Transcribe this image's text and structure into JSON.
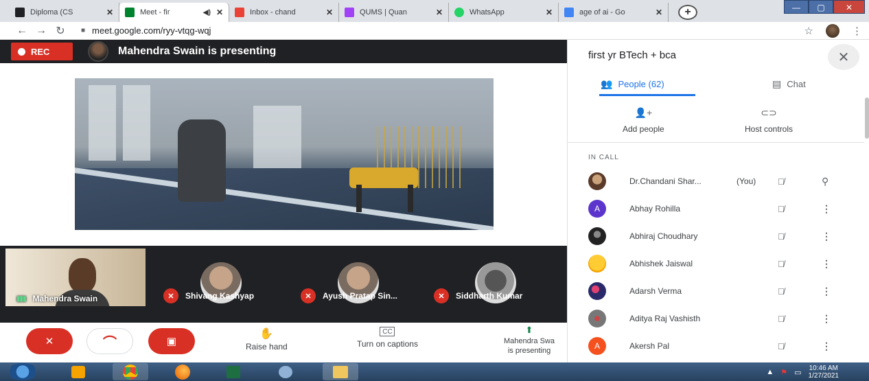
{
  "browser": {
    "tabs": [
      {
        "title": "Diploma (CS",
        "color": "#202124"
      },
      {
        "title": "Meet - fir",
        "color": "#00832d"
      },
      {
        "title": "Inbox - chand",
        "color": "#ea4335"
      },
      {
        "title": "QUMS | Quan",
        "color": "#a142f4"
      },
      {
        "title": "WhatsApp",
        "color": "#25d366"
      },
      {
        "title": "age of ai - Go",
        "color": "#4285f4"
      }
    ],
    "url": "meet.google.com/ryy-vtqg-wqj"
  },
  "meeting": {
    "rec_label": "REC",
    "presenting_text": "Mahendra Swain is presenting",
    "self_tile_name": "Mahendra Swain",
    "tiles": [
      {
        "name": "Shivang Kashyap"
      },
      {
        "name": "Ayush Pratap Sin..."
      },
      {
        "name": "Siddharth Kumar"
      }
    ],
    "controls": {
      "raise_hand": "Raise hand",
      "captions": "Turn on captions",
      "presenting_line1": "Mahendra Swa",
      "presenting_line2": "is presenting"
    }
  },
  "panel": {
    "title": "first yr BTech + bca",
    "tab_people": "People (62)",
    "tab_chat": "Chat",
    "add_people": "Add people",
    "host_controls": "Host controls",
    "in_call_label": "IN CALL",
    "people": [
      {
        "name": "Dr.Chandani Shar...",
        "you": "(You)",
        "avatar": "",
        "bg": "#8a6a50"
      },
      {
        "name": "Abhay Rohilla",
        "you": "",
        "avatar": "A",
        "bg": "#5c35cc"
      },
      {
        "name": "Abhiraj Choudhary",
        "you": "",
        "avatar": "",
        "bg": "#2b2b2b"
      },
      {
        "name": "Abhishek Jaiswal",
        "you": "",
        "avatar": "",
        "bg": "#f4b400"
      },
      {
        "name": "Adarsh Verma",
        "you": "",
        "avatar": "",
        "bg": "#3a3a8a"
      },
      {
        "name": "Aditya Raj Vashisth",
        "you": "",
        "avatar": "",
        "bg": "#7a7a7a"
      },
      {
        "name": "Akersh Pal",
        "you": "",
        "avatar": "A",
        "bg": "#f4511e"
      }
    ]
  },
  "taskbar": {
    "time": "10:46 AM",
    "date": "1/27/2021"
  }
}
